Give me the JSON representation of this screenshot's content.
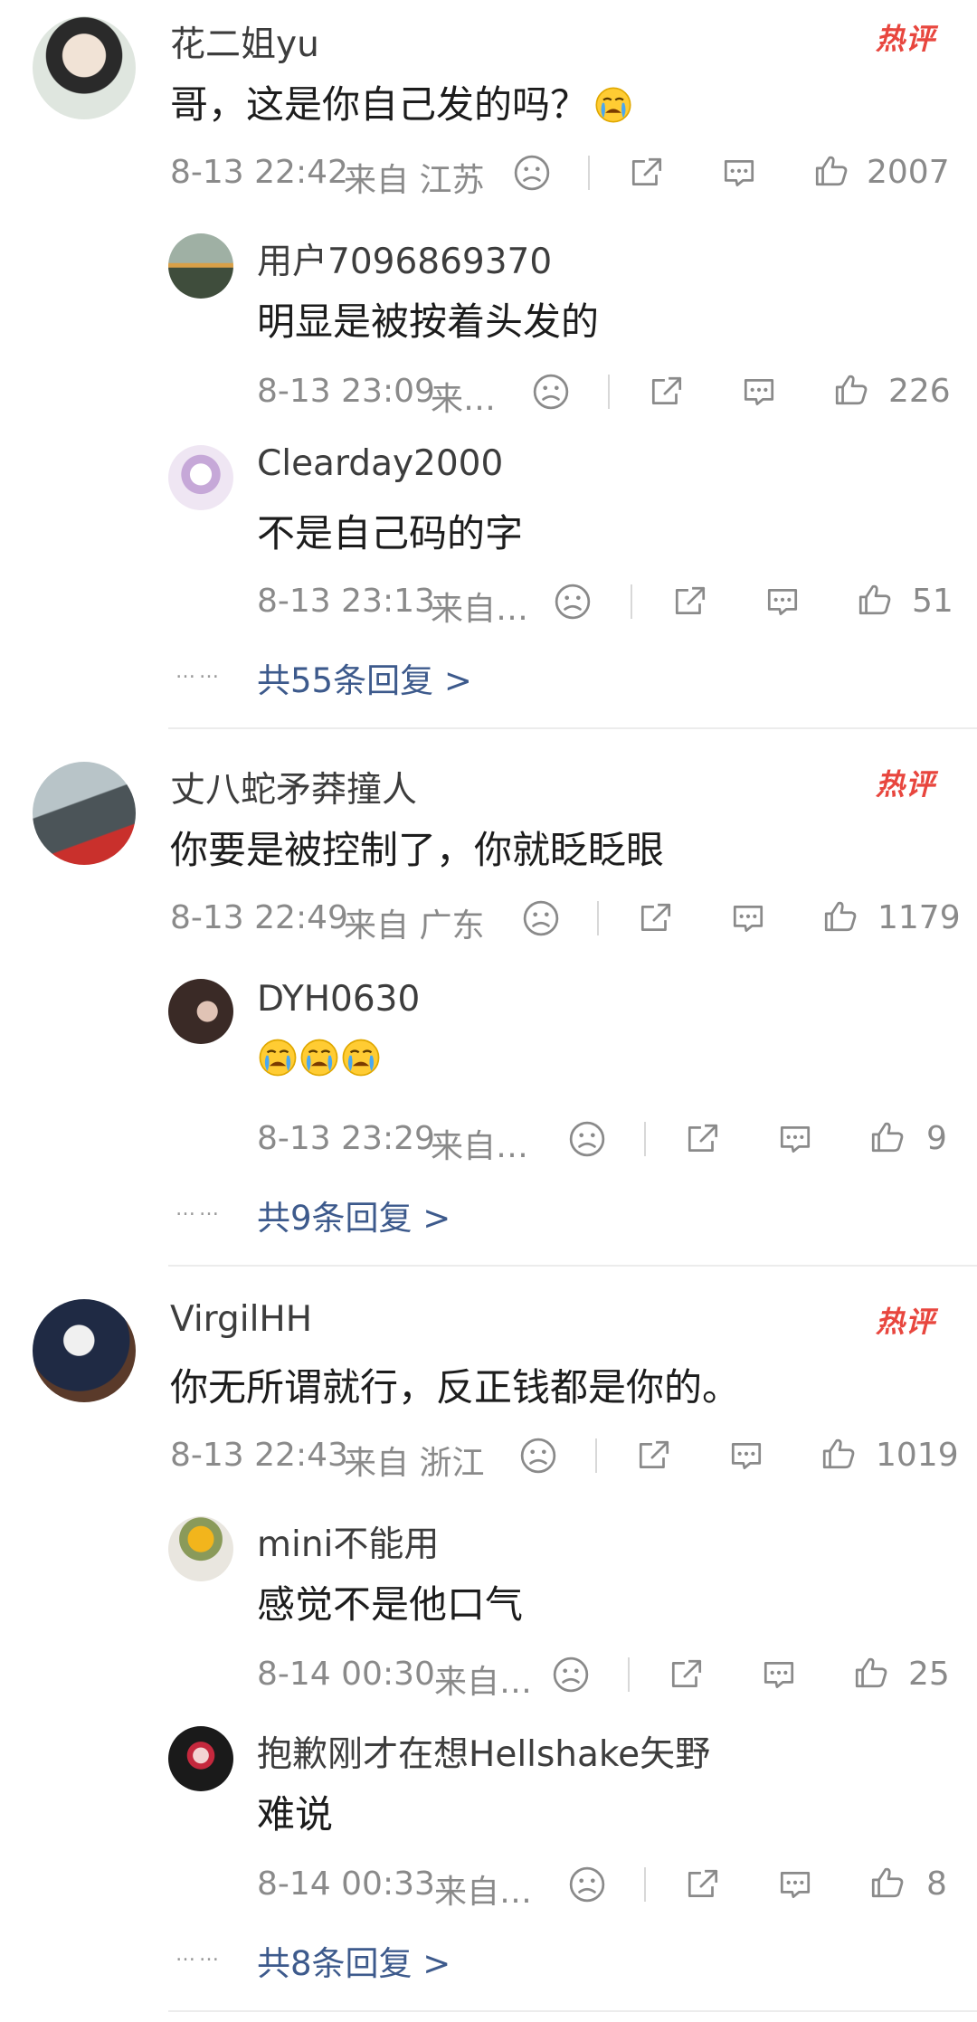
{
  "comments": [
    {
      "user": "花二姐yu",
      "text": "哥，这是你自己发的吗？",
      "time": "8-13 22:42",
      "location": "来自 江苏",
      "likes": "2007",
      "hot_label": "热评",
      "replies": [
        {
          "user": "用户7096869370",
          "text": "明显是被按着头发的",
          "time": "8-13 23:09",
          "location": "来…",
          "likes": "226"
        },
        {
          "user": "Clearday2000",
          "text": "不是自己码的字",
          "time": "8-13 23:13",
          "location": "来自…",
          "likes": "51"
        }
      ],
      "more": "共55条回复 >"
    },
    {
      "user": "丈八蛇矛莽撞人",
      "text": "你要是被控制了，你就眨眨眼",
      "time": "8-13 22:49",
      "location": "来自 广东",
      "likes": "1179",
      "hot_label": "热评",
      "replies": [
        {
          "user": "DYH0630",
          "text": "",
          "time": "8-13 23:29",
          "location": "来自…",
          "likes": "9"
        }
      ],
      "more": "共9条回复 >"
    },
    {
      "user": "VirgilHH",
      "text": "你无所谓就行，反正钱都是你的。",
      "time": "8-13 22:43",
      "location": "来自 浙江",
      "likes": "1019",
      "hot_label": "热评",
      "replies": [
        {
          "user": "mini不能用",
          "text": "感觉不是他口气",
          "time": "8-14 00:30",
          "location": "来自…",
          "likes": "25"
        },
        {
          "user": "抱歉刚才在想Hellshake矢野",
          "text": "难说",
          "time": "8-14 00:33",
          "location": "来自…",
          "likes": "8"
        }
      ],
      "more": "共8条回复 >"
    }
  ],
  "ui": {
    "more_dots": "……",
    "accent_color": "#3d5a8c",
    "hot_color": "#e8463e",
    "meta_color": "#8a8a8a"
  }
}
